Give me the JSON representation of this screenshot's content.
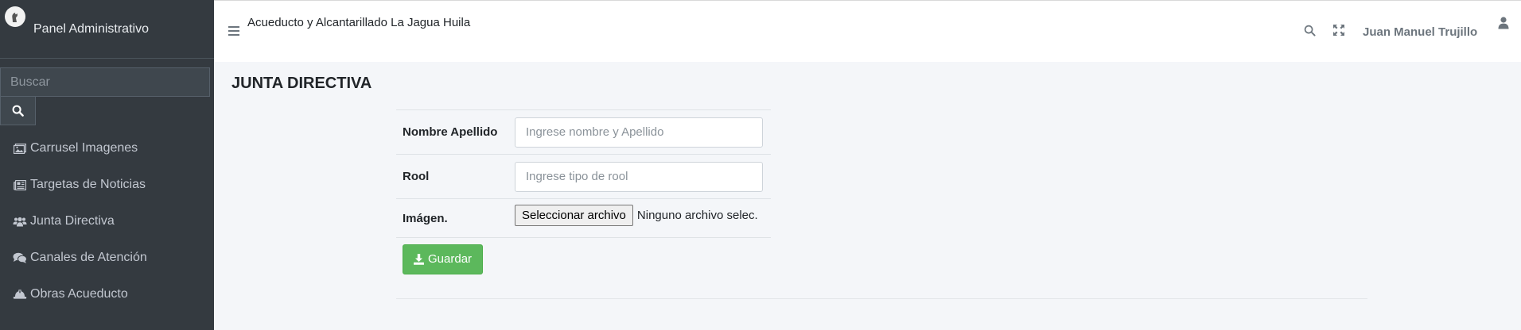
{
  "sidebar": {
    "brand": "Panel Administrativo",
    "search_placeholder": "Buscar",
    "items": [
      {
        "label": "Carrusel Imagenes",
        "icon": "images-icon"
      },
      {
        "label": "Targetas de Noticias",
        "icon": "newspaper-icon"
      },
      {
        "label": "Junta Directiva",
        "icon": "users-icon"
      },
      {
        "label": "Canales de Atención",
        "icon": "comments-icon"
      },
      {
        "label": "Obras Acueducto",
        "icon": "hard-hat-icon"
      }
    ]
  },
  "navbar": {
    "title": "Acueducto y Alcantarillado La Jagua Huila",
    "user_name": "Juan Manuel Trujillo"
  },
  "main": {
    "page_title": "JUNTA DIRECTIVA",
    "form": {
      "name_label": "Nombre Apellido",
      "name_placeholder": "Ingrese nombre y Apellido",
      "role_label": "Rool",
      "role_placeholder": "Ingrese tipo de rool",
      "image_label": "Imágen.",
      "file_button_label": "Seleccionar archivo",
      "file_status": "Ninguno archivo selec.",
      "save_label": "Guardar"
    }
  },
  "colors": {
    "sidebar_bg": "#343a40",
    "save_button": "#5cb85c",
    "content_bg": "#f4f6f9"
  }
}
